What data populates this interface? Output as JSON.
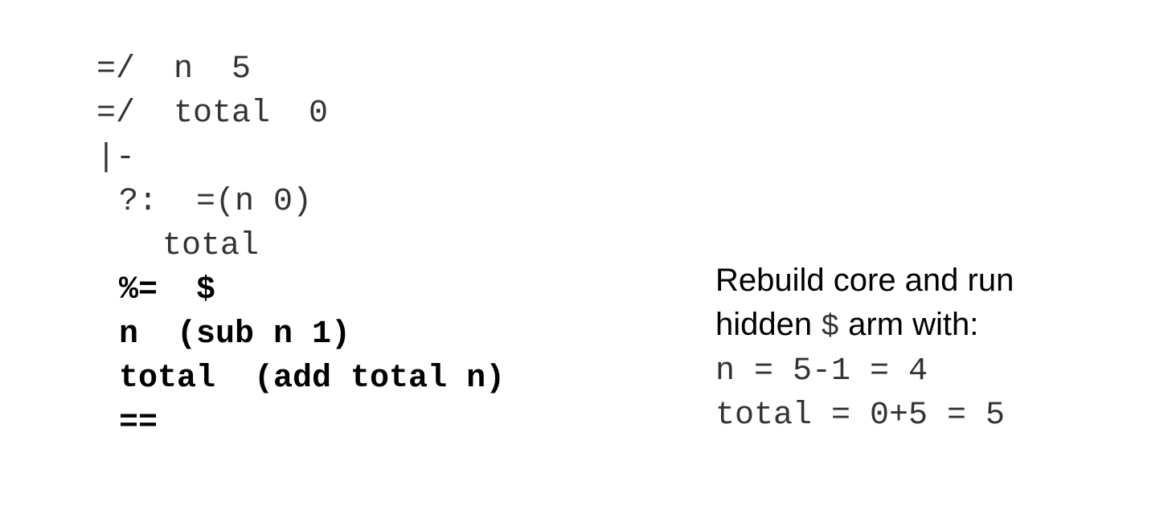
{
  "code": {
    "lines": [
      "=/  n  5",
      "=/  total  0",
      "|-",
      "?:  =(n 0)",
      "total",
      "%=  $",
      "n  (sub n 1)",
      "total  (add total n)",
      "=="
    ]
  },
  "note": {
    "line1": "Rebuild core and run",
    "line2_before": "hidden ",
    "line2_symbol": "$",
    "line2_after": " arm with:",
    "result1": "n = 5-1 = 4",
    "result2": "total = 0+5 = 5"
  }
}
